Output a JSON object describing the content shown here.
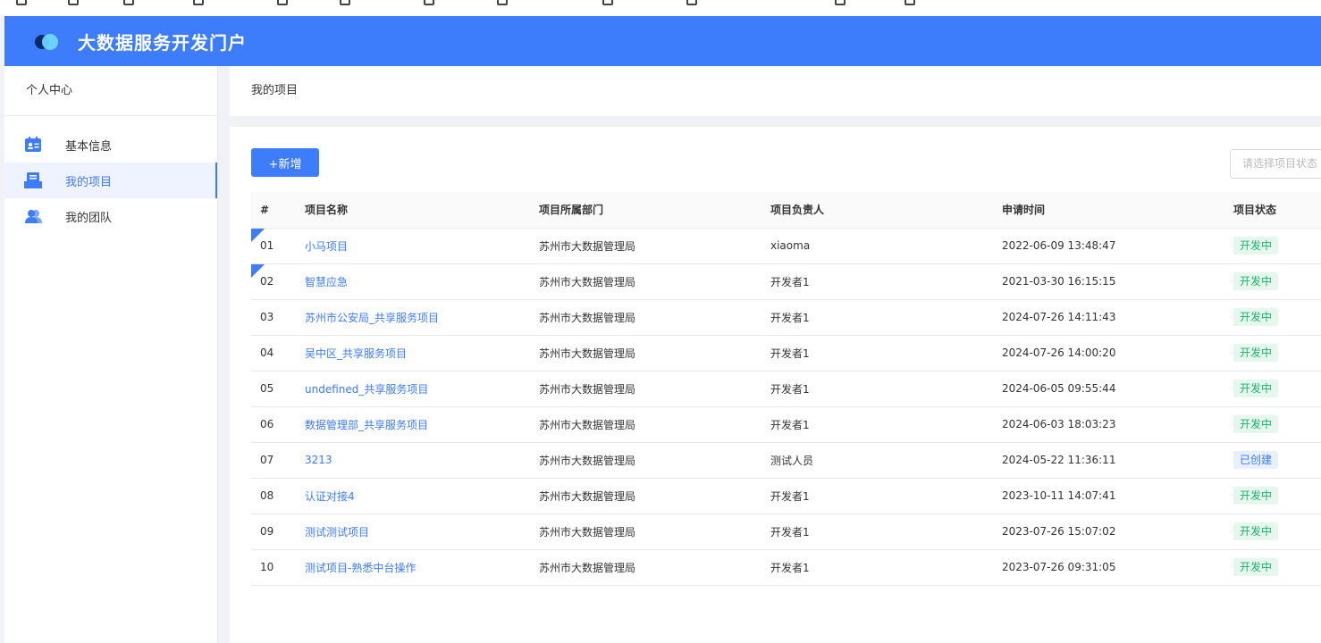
{
  "app": {
    "title": "大数据服务开发门户"
  },
  "sidebar": {
    "title": "个人中心",
    "items": [
      {
        "label": "基本信息",
        "icon": "id-card-icon",
        "active": false
      },
      {
        "label": "我的项目",
        "icon": "project-icon",
        "active": true
      },
      {
        "label": "我的团队",
        "icon": "team-icon",
        "active": false
      }
    ]
  },
  "breadcrumb": "我的项目",
  "toolbar": {
    "add_label": "+新增",
    "status_placeholder": "请选择项目状态"
  },
  "table": {
    "columns": [
      "#",
      "项目名称",
      "项目所属部门",
      "项目负责人",
      "申请时间",
      "项目状态"
    ],
    "rows": [
      {
        "no": "01",
        "name": "小马项目",
        "dept": "苏州市大数据管理局",
        "owner": "xiaoma",
        "time": "2022-06-09 13:48:47",
        "status": "开发中",
        "marked": true
      },
      {
        "no": "02",
        "name": "智慧应急",
        "dept": "苏州市大数据管理局",
        "owner": "开发者1",
        "time": "2021-03-30 16:15:15",
        "status": "开发中",
        "marked": true
      },
      {
        "no": "03",
        "name": "苏州市公安局_共享服务项目",
        "dept": "苏州市大数据管理局",
        "owner": "开发者1",
        "time": "2024-07-26 14:11:43",
        "status": "开发中",
        "marked": false
      },
      {
        "no": "04",
        "name": "吴中区_共享服务项目",
        "dept": "苏州市大数据管理局",
        "owner": "开发者1",
        "time": "2024-07-26 14:00:20",
        "status": "开发中",
        "marked": false
      },
      {
        "no": "05",
        "name": "undefined_共享服务项目",
        "dept": "苏州市大数据管理局",
        "owner": "开发者1",
        "time": "2024-06-05 09:55:44",
        "status": "开发中",
        "marked": false
      },
      {
        "no": "06",
        "name": "数据管理部_共享服务项目",
        "dept": "苏州市大数据管理局",
        "owner": "开发者1",
        "time": "2024-06-03 18:03:23",
        "status": "开发中",
        "marked": false
      },
      {
        "no": "07",
        "name": "3213",
        "dept": "苏州市大数据管理局",
        "owner": "测试人员",
        "time": "2024-05-22 11:36:11",
        "status": "已创建",
        "marked": false
      },
      {
        "no": "08",
        "name": "认证对接4",
        "dept": "苏州市大数据管理局",
        "owner": "开发者1",
        "time": "2023-10-11 14:07:41",
        "status": "开发中",
        "marked": false
      },
      {
        "no": "09",
        "name": "测试测试项目",
        "dept": "苏州市大数据管理局",
        "owner": "开发者1",
        "time": "2023-07-26 15:07:02",
        "status": "开发中",
        "marked": false
      },
      {
        "no": "10",
        "name": "测试项目-熟悉中台操作",
        "dept": "苏州市大数据管理局",
        "owner": "开发者1",
        "time": "2023-07-26 09:31:05",
        "status": "开发中",
        "marked": false
      }
    ]
  },
  "colors": {
    "primary": "#3d7cfb",
    "status_dev": "#19b36a",
    "status_created": "#3d7cfb"
  }
}
